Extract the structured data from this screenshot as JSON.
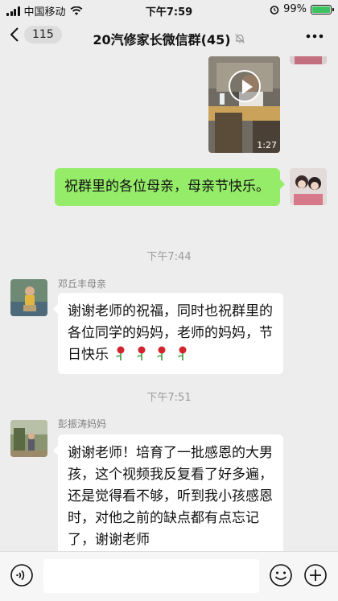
{
  "status": {
    "carrier": "中国移动",
    "time": "下午7:59",
    "battery_pct": "99%",
    "battery_level": 0.99,
    "icons": [
      "signal-icon",
      "wifi-icon",
      "alarm-icon",
      "battery-icon"
    ]
  },
  "nav": {
    "unread": "115",
    "title": "20汽修家长微信群(45)",
    "icons": [
      "back-chevron-icon",
      "mute-bell-icon",
      "more-dots-icon"
    ]
  },
  "messages": {
    "video_duration": "1:27",
    "out_text": "祝群里的各位母亲，母亲节快乐。",
    "ts1": "下午7:44",
    "sender1": "邓丘丰母亲",
    "in1_text": "谢谢老师的祝福，同时也祝群里的各位同学的妈妈，老师的妈妈，节日快乐",
    "ts2": "下午7:51",
    "sender2": "彭振涛妈妈",
    "in2_text": "谢谢老师！培育了一批感恩的大男孩，这个视频我反复看了好多遍，还是觉得看不够，听到我小孩感恩时，对他之前的缺点都有点忘记了，谢谢老师"
  },
  "input": {
    "icons": [
      "voice-icon",
      "emoji-icon",
      "add-icon"
    ]
  },
  "colors": {
    "background": "#ededed",
    "outgoing_bubble": "#95ec69",
    "incoming_bubble": "#ffffff",
    "timestamp": "#9a9a9a",
    "battery_fill": "#3cc35f"
  }
}
